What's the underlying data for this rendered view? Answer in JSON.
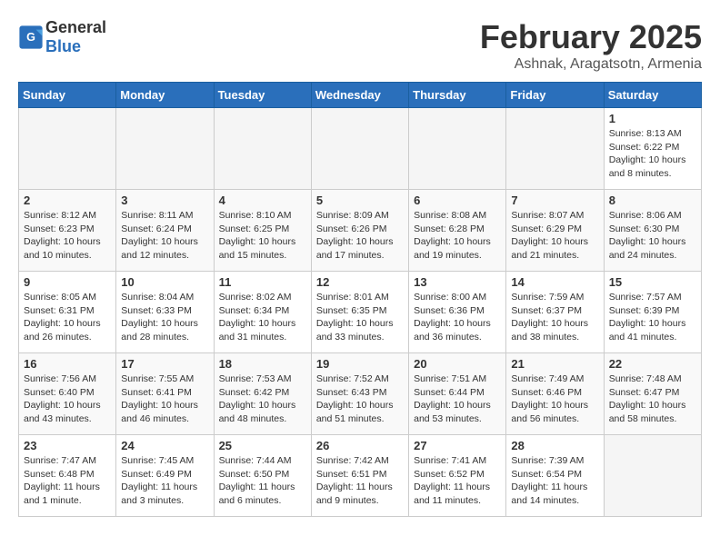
{
  "header": {
    "logo_general": "General",
    "logo_blue": "Blue",
    "month_title": "February 2025",
    "location": "Ashnak, Aragatsotn, Armenia"
  },
  "weekdays": [
    "Sunday",
    "Monday",
    "Tuesday",
    "Wednesday",
    "Thursday",
    "Friday",
    "Saturday"
  ],
  "weeks": [
    {
      "bg": "white",
      "days": [
        {
          "num": "",
          "info": ""
        },
        {
          "num": "",
          "info": ""
        },
        {
          "num": "",
          "info": ""
        },
        {
          "num": "",
          "info": ""
        },
        {
          "num": "",
          "info": ""
        },
        {
          "num": "",
          "info": ""
        },
        {
          "num": "1",
          "info": "Sunrise: 8:13 AM\nSunset: 6:22 PM\nDaylight: 10 hours and 8 minutes."
        }
      ]
    },
    {
      "bg": "light",
      "days": [
        {
          "num": "2",
          "info": "Sunrise: 8:12 AM\nSunset: 6:23 PM\nDaylight: 10 hours and 10 minutes."
        },
        {
          "num": "3",
          "info": "Sunrise: 8:11 AM\nSunset: 6:24 PM\nDaylight: 10 hours and 12 minutes."
        },
        {
          "num": "4",
          "info": "Sunrise: 8:10 AM\nSunset: 6:25 PM\nDaylight: 10 hours and 15 minutes."
        },
        {
          "num": "5",
          "info": "Sunrise: 8:09 AM\nSunset: 6:26 PM\nDaylight: 10 hours and 17 minutes."
        },
        {
          "num": "6",
          "info": "Sunrise: 8:08 AM\nSunset: 6:28 PM\nDaylight: 10 hours and 19 minutes."
        },
        {
          "num": "7",
          "info": "Sunrise: 8:07 AM\nSunset: 6:29 PM\nDaylight: 10 hours and 21 minutes."
        },
        {
          "num": "8",
          "info": "Sunrise: 8:06 AM\nSunset: 6:30 PM\nDaylight: 10 hours and 24 minutes."
        }
      ]
    },
    {
      "bg": "white",
      "days": [
        {
          "num": "9",
          "info": "Sunrise: 8:05 AM\nSunset: 6:31 PM\nDaylight: 10 hours and 26 minutes."
        },
        {
          "num": "10",
          "info": "Sunrise: 8:04 AM\nSunset: 6:33 PM\nDaylight: 10 hours and 28 minutes."
        },
        {
          "num": "11",
          "info": "Sunrise: 8:02 AM\nSunset: 6:34 PM\nDaylight: 10 hours and 31 minutes."
        },
        {
          "num": "12",
          "info": "Sunrise: 8:01 AM\nSunset: 6:35 PM\nDaylight: 10 hours and 33 minutes."
        },
        {
          "num": "13",
          "info": "Sunrise: 8:00 AM\nSunset: 6:36 PM\nDaylight: 10 hours and 36 minutes."
        },
        {
          "num": "14",
          "info": "Sunrise: 7:59 AM\nSunset: 6:37 PM\nDaylight: 10 hours and 38 minutes."
        },
        {
          "num": "15",
          "info": "Sunrise: 7:57 AM\nSunset: 6:39 PM\nDaylight: 10 hours and 41 minutes."
        }
      ]
    },
    {
      "bg": "light",
      "days": [
        {
          "num": "16",
          "info": "Sunrise: 7:56 AM\nSunset: 6:40 PM\nDaylight: 10 hours and 43 minutes."
        },
        {
          "num": "17",
          "info": "Sunrise: 7:55 AM\nSunset: 6:41 PM\nDaylight: 10 hours and 46 minutes."
        },
        {
          "num": "18",
          "info": "Sunrise: 7:53 AM\nSunset: 6:42 PM\nDaylight: 10 hours and 48 minutes."
        },
        {
          "num": "19",
          "info": "Sunrise: 7:52 AM\nSunset: 6:43 PM\nDaylight: 10 hours and 51 minutes."
        },
        {
          "num": "20",
          "info": "Sunrise: 7:51 AM\nSunset: 6:44 PM\nDaylight: 10 hours and 53 minutes."
        },
        {
          "num": "21",
          "info": "Sunrise: 7:49 AM\nSunset: 6:46 PM\nDaylight: 10 hours and 56 minutes."
        },
        {
          "num": "22",
          "info": "Sunrise: 7:48 AM\nSunset: 6:47 PM\nDaylight: 10 hours and 58 minutes."
        }
      ]
    },
    {
      "bg": "white",
      "days": [
        {
          "num": "23",
          "info": "Sunrise: 7:47 AM\nSunset: 6:48 PM\nDaylight: 11 hours and 1 minute."
        },
        {
          "num": "24",
          "info": "Sunrise: 7:45 AM\nSunset: 6:49 PM\nDaylight: 11 hours and 3 minutes."
        },
        {
          "num": "25",
          "info": "Sunrise: 7:44 AM\nSunset: 6:50 PM\nDaylight: 11 hours and 6 minutes."
        },
        {
          "num": "26",
          "info": "Sunrise: 7:42 AM\nSunset: 6:51 PM\nDaylight: 11 hours and 9 minutes."
        },
        {
          "num": "27",
          "info": "Sunrise: 7:41 AM\nSunset: 6:52 PM\nDaylight: 11 hours and 11 minutes."
        },
        {
          "num": "28",
          "info": "Sunrise: 7:39 AM\nSunset: 6:54 PM\nDaylight: 11 hours and 14 minutes."
        },
        {
          "num": "",
          "info": ""
        }
      ]
    }
  ]
}
